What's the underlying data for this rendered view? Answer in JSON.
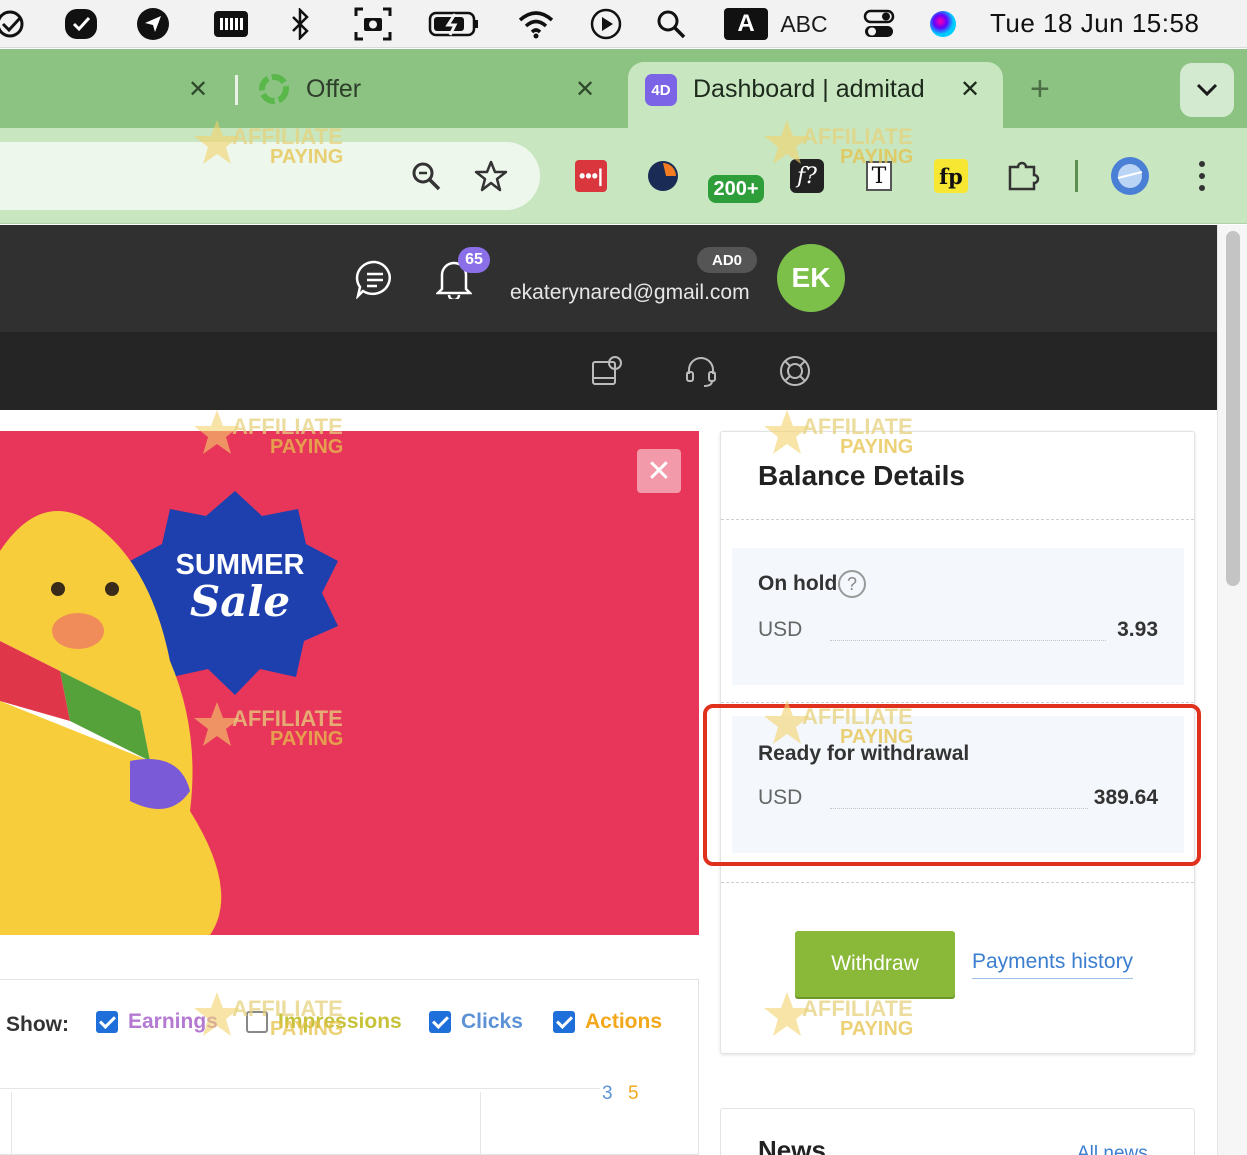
{
  "menubar": {
    "input_source_letter": "A",
    "input_source": "ABC",
    "clock": "Tue 18 Jun  15:58"
  },
  "browser": {
    "tabs": [
      {
        "label": "Offer",
        "close": "✕"
      },
      {
        "label": "Dashboard | admitad",
        "close": "✕",
        "favicon": "4D"
      }
    ],
    "first_tab_close": "✕",
    "new_tab": "+",
    "extensions_badge": "200+",
    "ext_f": "f?",
    "ext_t": "T",
    "ext_fp": "fp"
  },
  "header": {
    "notifications_count": "65",
    "account_tag": "AD0",
    "email": "ekaterynared@gmail.com",
    "avatar_initials": "EK"
  },
  "banner": {
    "badge_line1": "SUMMER",
    "badge_line2": "Sale",
    "close": "✕"
  },
  "balance": {
    "title": "Balance Details",
    "on_hold_label": "On hold",
    "help": "?",
    "on_hold_currency": "USD",
    "on_hold_amount": "3.93",
    "ready_label": "Ready for withdrawal",
    "ready_currency": "USD",
    "ready_amount": "389.64",
    "withdraw_button": "Withdraw",
    "history_link": "Payments history"
  },
  "filters": {
    "show_label": "Show:",
    "earnings": "Earnings",
    "impressions": "Impressions",
    "clicks": "Clicks",
    "actions": "Actions",
    "legend_a": "3",
    "legend_b": "5"
  },
  "news": {
    "title": "News",
    "all_link": "All news"
  },
  "watermark": {
    "line1": "AFFILIATE",
    "line2": "PAYING"
  },
  "colors": {
    "tabstrip": "#8cc383",
    "active_tab": "#c8e6c0",
    "banner": "#e8365a",
    "highlight": "#e0301e",
    "withdraw": "#8ab839",
    "earnings": "#b47ad1",
    "impressions": "#c7c23a",
    "clicks": "#5d93d6",
    "actions": "#f2a81a"
  }
}
